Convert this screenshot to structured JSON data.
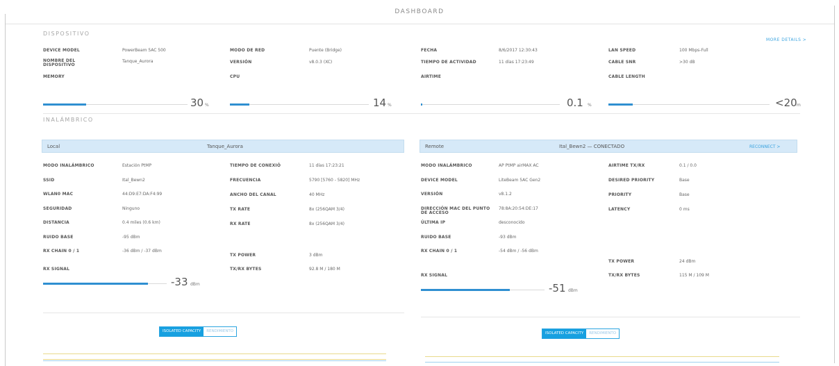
{
  "page": {
    "title": "DASHBOARD"
  },
  "device": {
    "section_title": "DISPOSITIVO",
    "more_details": "MORE DETAILS  >",
    "fields": {
      "device_model": {
        "label": "DEVICE MODEL",
        "value": "PowerBeam 5AC 500"
      },
      "nombre": {
        "label": "NOMBRE DEL DISPOSITIVO",
        "value": "Tanque_Aurora"
      },
      "modo_red": {
        "label": "MODO DE RED",
        "value": "Puente (Bridge)"
      },
      "version": {
        "label": "VERSIÓN",
        "value": "v8.0.3 (XC)"
      },
      "fecha": {
        "label": "FECHA",
        "value": "8/6/2017 12:30:43"
      },
      "tiempo_actividad": {
        "label": "TIEMPO DE ACTIVIDAD",
        "value": "11 días 17:23:49"
      },
      "lan_speed": {
        "label": "LAN SPEED",
        "value": "100 Mbps-Full"
      },
      "cable_snr": {
        "label": "CABLE SNR",
        "value": ">30 dB"
      }
    },
    "meters": {
      "memory": {
        "label": "MEMORY",
        "value": "30",
        "unit": "%",
        "fraction": 0.3
      },
      "cpu": {
        "label": "CPU",
        "value": "14",
        "unit": "%",
        "fraction": 0.14
      },
      "airtime": {
        "label": "AIRTIME",
        "value": "0.1",
        "unit": "%",
        "fraction": 0.001
      },
      "cable_length": {
        "label": "CABLE LENGTH",
        "value": "<20",
        "unit": "m",
        "fraction": 0.15
      }
    }
  },
  "wireless": {
    "section_title": "INALÁMBRICO",
    "local": {
      "header_label": "Local",
      "header_name": "Tanque_Aurora",
      "col1": [
        {
          "label": "MODO INALÁMBRICO",
          "value": "Estación PtMP"
        },
        {
          "label": "SSID",
          "value": "Ital_Bewn2"
        },
        {
          "label": "WLAN0 MAC",
          "value": "44:D9:E7:DA:F4:99"
        },
        {
          "label": "SEGURIDAD",
          "value": "Ninguno"
        },
        {
          "label": "DISTANCIA",
          "value": "0.4 miles (0.6 km)"
        },
        {
          "label": "RUIDO BASE",
          "value": "-95 dBm"
        },
        {
          "label": "RX CHAIN 0 / 1",
          "value": "-36 dBm / -37 dBm"
        }
      ],
      "col2": [
        {
          "label": "TIEMPO DE CONEXIÓ",
          "value": "11 días 17:23:21"
        },
        {
          "label": "FRECUENCIA",
          "value": "5790 [5760 - 5820] MHz"
        },
        {
          "label": "ANCHO DEL CANAL",
          "value": "40 MHz"
        },
        {
          "label": "TX RATE",
          "value": "8x (256QAM 3/4)"
        },
        {
          "label": "RX RATE",
          "value": "8x (256QAM 3/4)"
        }
      ],
      "tx_power": {
        "label": "TX POWER",
        "value": "3 dBm"
      },
      "txrx_bytes": {
        "label": "TX/RX BYTES",
        "value": "92.8 M / 180 M"
      },
      "rx_signal": {
        "label": "RX SIGNAL",
        "value": "-33",
        "unit": "dBm",
        "fraction": 0.85
      }
    },
    "remote": {
      "header_label": "Remote",
      "header_name": "Ital_Bewn2 — CONECTADO",
      "header_link": "RECONNECT  >",
      "col1": [
        {
          "label": "MODO INALÁMBRICO",
          "value": "AP PtMP airMAX AC"
        },
        {
          "label": "DEVICE MODEL",
          "value": "LiteBeam 5AC Gen2"
        },
        {
          "label": "VERSIÓN",
          "value": "v8.1.2"
        },
        {
          "label": "DIRECCIÓN MAC DEL PUNTO DE ACCESO",
          "value": "78:8A:20:54:DE:17"
        },
        {
          "label": "ÚLTIMA IP",
          "value": "desconocido"
        },
        {
          "label": "RUIDO BASE",
          "value": "-93 dBm"
        },
        {
          "label": "RX CHAIN 0 / 1",
          "value": "-54 dBm / -56 dBm"
        }
      ],
      "col2": [
        {
          "label": "AIRTIME TX/RX",
          "value": "0.1 / 0.0"
        },
        {
          "label": "DESIRED PRIORITY",
          "value": "Base"
        },
        {
          "label": "PRIORITY",
          "value": "Base"
        },
        {
          "label": "LATENCY",
          "value": "0 ms"
        }
      ],
      "tx_power": {
        "label": "TX POWER",
        "value": "24 dBm"
      },
      "txrx_bytes": {
        "label": "TX/RX BYTES",
        "value": "115 M / 109 M"
      },
      "rx_signal": {
        "label": "RX SIGNAL",
        "value": "-51",
        "unit": "dBm",
        "fraction": 0.72
      }
    }
  },
  "capacity_toggle": {
    "left": {
      "active": "ISOLATED CAPACITY",
      "inactive": "RENDIMIENTO"
    },
    "right": {
      "active": "ISOLATED CAPACITY",
      "inactive": "RENDIMIENTO"
    }
  },
  "colors": {
    "accent": "#2f8fd1",
    "panel_header": "#d6e9f8",
    "link": "#3aa3df",
    "chart_yellow": "#e9d98a",
    "chart_blue": "#9fd0ee"
  }
}
